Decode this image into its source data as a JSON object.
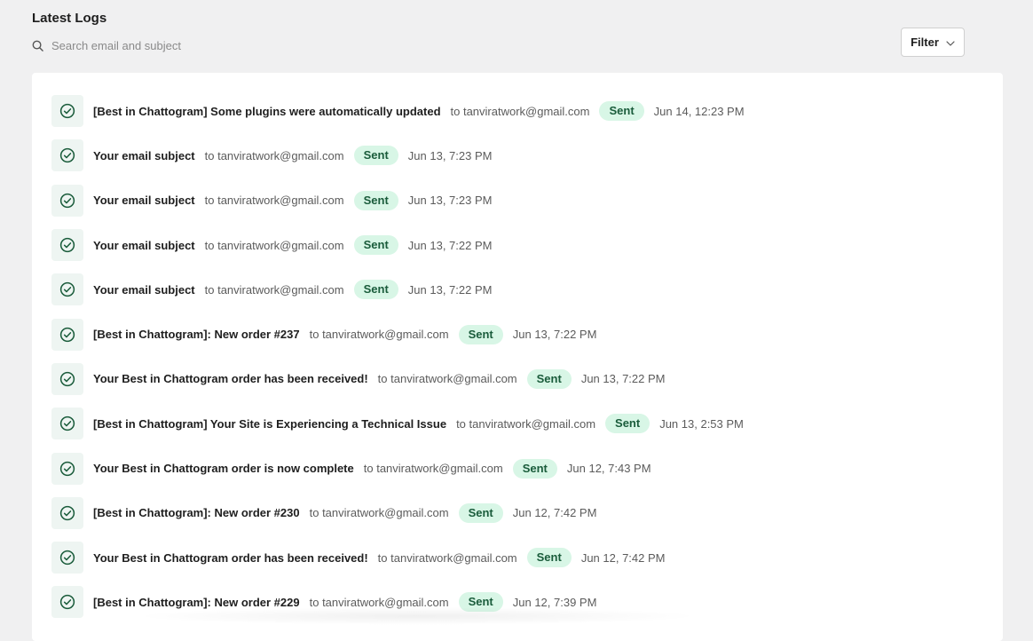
{
  "header": {
    "title": "Latest Logs",
    "search_placeholder": "Search email and subject",
    "filter_label": "Filter"
  },
  "colors": {
    "badge_bg": "#d8f6e6",
    "badge_text": "#1a5c3b",
    "icon_accent": "#1a5c3b"
  },
  "logs": [
    {
      "subject": "[Best in Chattogram] Some plugins were automatically updated",
      "recipient": "to tanviratwork@gmail.com",
      "status": "Sent",
      "date": "Jun 14, 12:23 PM"
    },
    {
      "subject": "Your email subject",
      "recipient": "to tanviratwork@gmail.com",
      "status": "Sent",
      "date": "Jun 13, 7:23 PM"
    },
    {
      "subject": "Your email subject",
      "recipient": "to tanviratwork@gmail.com",
      "status": "Sent",
      "date": "Jun 13, 7:23 PM"
    },
    {
      "subject": "Your email subject",
      "recipient": "to tanviratwork@gmail.com",
      "status": "Sent",
      "date": "Jun 13, 7:22 PM"
    },
    {
      "subject": "Your email subject",
      "recipient": "to tanviratwork@gmail.com",
      "status": "Sent",
      "date": "Jun 13, 7:22 PM"
    },
    {
      "subject": "[Best in Chattogram]: New order #237",
      "recipient": "to tanviratwork@gmail.com",
      "status": "Sent",
      "date": "Jun 13, 7:22 PM"
    },
    {
      "subject": "Your Best in Chattogram order has been received!",
      "recipient": "to tanviratwork@gmail.com",
      "status": "Sent",
      "date": "Jun 13, 7:22 PM"
    },
    {
      "subject": "[Best in Chattogram] Your Site is Experiencing a Technical Issue",
      "recipient": "to tanviratwork@gmail.com",
      "status": "Sent",
      "date": "Jun 13, 2:53 PM"
    },
    {
      "subject": "Your Best in Chattogram order is now complete",
      "recipient": "to tanviratwork@gmail.com",
      "status": "Sent",
      "date": "Jun 12, 7:43 PM"
    },
    {
      "subject": "[Best in Chattogram]: New order #230",
      "recipient": "to tanviratwork@gmail.com",
      "status": "Sent",
      "date": "Jun 12, 7:42 PM"
    },
    {
      "subject": "Your Best in Chattogram order has been received!",
      "recipient": "to tanviratwork@gmail.com",
      "status": "Sent",
      "date": "Jun 12, 7:42 PM"
    },
    {
      "subject": "[Best in Chattogram]: New order #229",
      "recipient": "to tanviratwork@gmail.com",
      "status": "Sent",
      "date": "Jun 12, 7:39 PM"
    }
  ]
}
